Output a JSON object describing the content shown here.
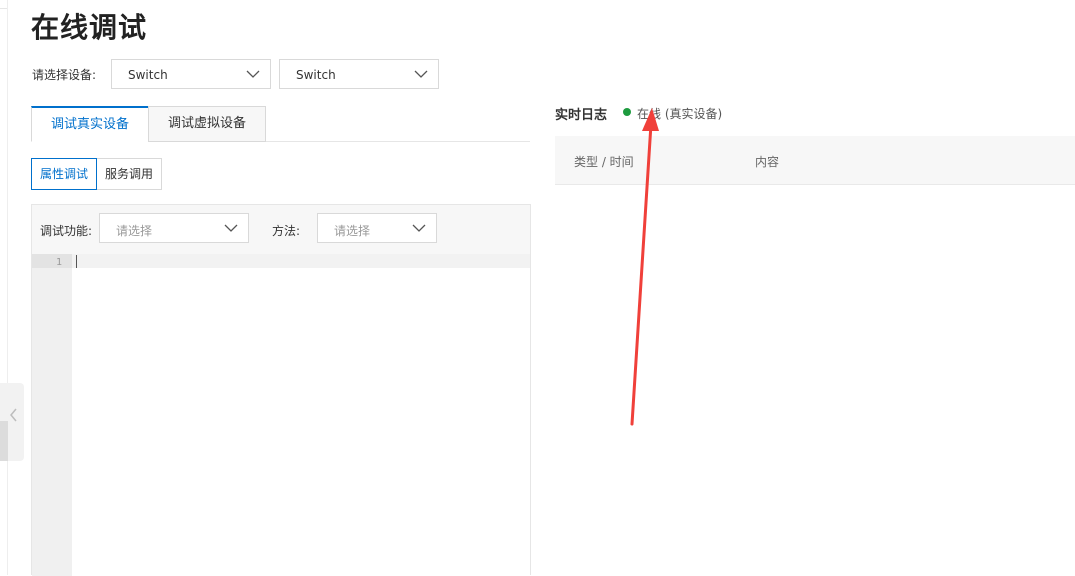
{
  "page": {
    "title": "在线调试"
  },
  "device_select": {
    "label": "请选择设备:",
    "product": "Switch",
    "device": "Switch"
  },
  "tabs": [
    {
      "label": "调试真实设备",
      "active": true
    },
    {
      "label": "调试虚拟设备",
      "active": false
    }
  ],
  "mode_buttons": [
    {
      "label": "属性调试",
      "active": true
    },
    {
      "label": "服务调用",
      "active": false
    }
  ],
  "debug_panel": {
    "function_label": "调试功能:",
    "function_placeholder": "请选择",
    "method_label": "方法:",
    "method_placeholder": "请选择",
    "line_number": "1"
  },
  "log": {
    "title": "实时日志",
    "status": "在线 (真实设备)",
    "status_color": "#1e9b3f",
    "columns": [
      "类型 / 时间",
      "内容"
    ]
  },
  "colors": {
    "accent": "#0070cc",
    "annotation_arrow": "#f0403a"
  },
  "icons": [
    "chevron-left-icon",
    "chevron-down-icon",
    "status-dot-icon",
    "red-arrow-annotation"
  ]
}
